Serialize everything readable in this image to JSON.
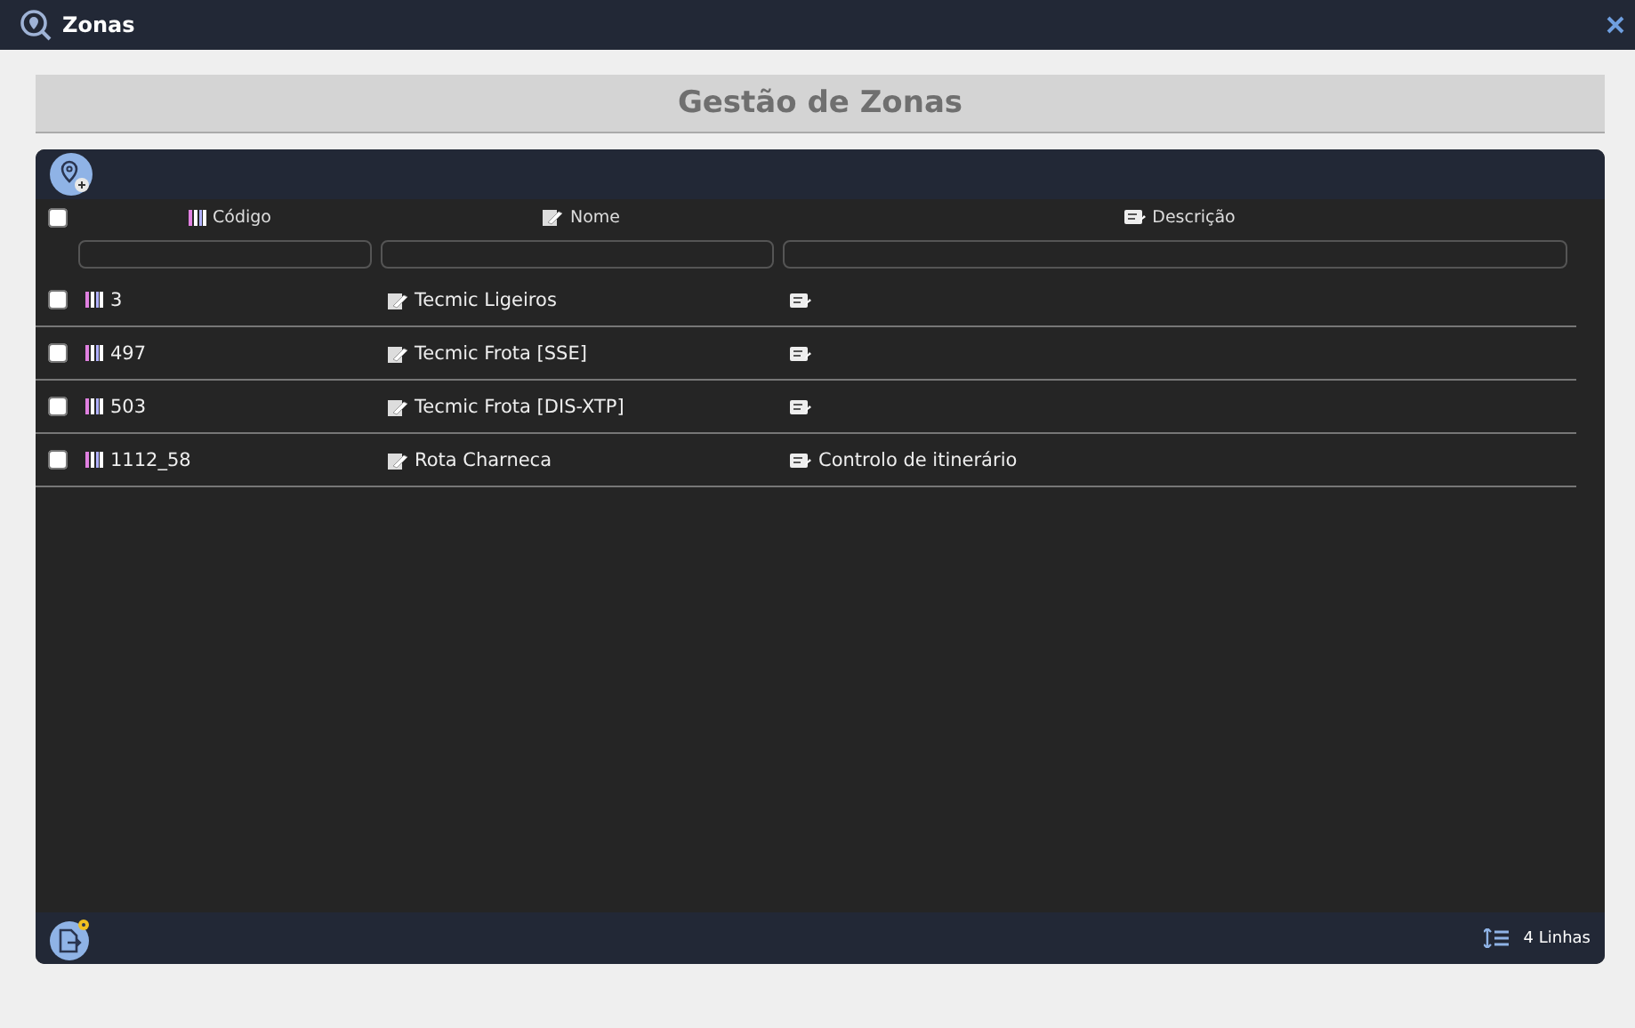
{
  "window": {
    "title": "Zonas"
  },
  "heading": "Gestão de Zonas",
  "table": {
    "select_all": {
      "checked": false
    },
    "columns": [
      {
        "label": "Código",
        "kind": "code"
      },
      {
        "label": "Nome",
        "kind": "name"
      },
      {
        "label": "Descrição",
        "kind": "desc"
      }
    ],
    "rows": [
      {
        "selected": false,
        "cells": [
          "3",
          "Tecmic Ligeiros",
          ""
        ]
      },
      {
        "selected": false,
        "cells": [
          "497",
          "Tecmic Frota [SSE]",
          ""
        ]
      },
      {
        "selected": false,
        "cells": [
          "503",
          "Tecmic Frota [DIS-XTP]",
          ""
        ]
      },
      {
        "selected": false,
        "cells": [
          "1112_58",
          "Rota Charneca",
          "Controlo de itinerário"
        ]
      }
    ]
  },
  "footer": {
    "row_count": "4 Linhas"
  }
}
